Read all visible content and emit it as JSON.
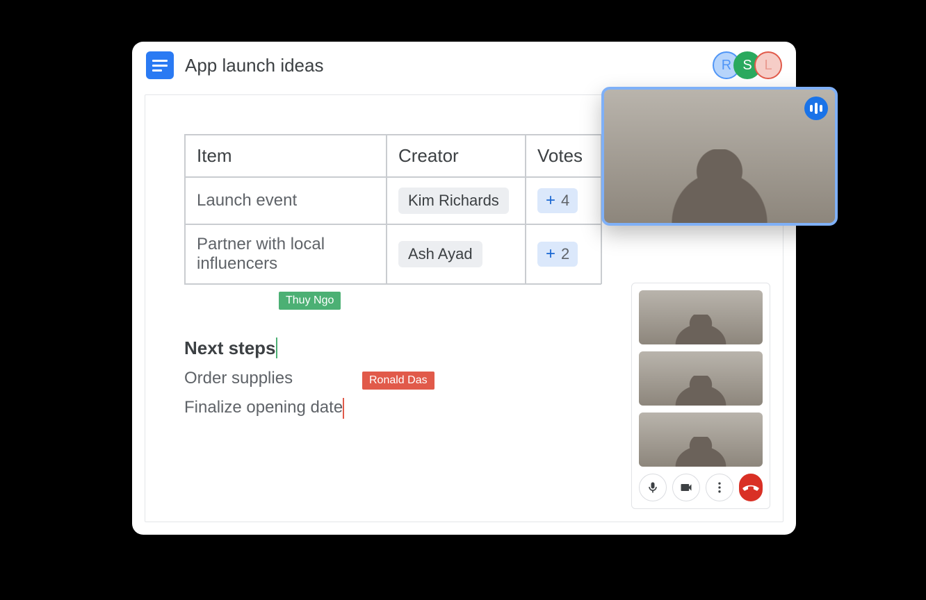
{
  "header": {
    "title": "App launch ideas",
    "presence": [
      {
        "initial": "R",
        "color": "blue"
      },
      {
        "initial": "S",
        "color": "green"
      },
      {
        "initial": "L",
        "color": "red"
      }
    ]
  },
  "table": {
    "columns": [
      "Item",
      "Creator",
      "Votes"
    ],
    "rows": [
      {
        "item": "Launch event",
        "creator": "Kim Richards",
        "votes": 4
      },
      {
        "item": "Partner with local influencers",
        "creator": "Ash Ayad",
        "votes": 2
      }
    ]
  },
  "next_steps": {
    "heading": "Next steps",
    "items": [
      "Order supplies",
      "Finalize opening date"
    ]
  },
  "cursors": {
    "green_user": "Thuy Ngo",
    "red_user": "Ronald Das"
  },
  "meet": {
    "participant_count": 4,
    "controls": [
      "mic",
      "camera",
      "more",
      "hangup"
    ]
  }
}
